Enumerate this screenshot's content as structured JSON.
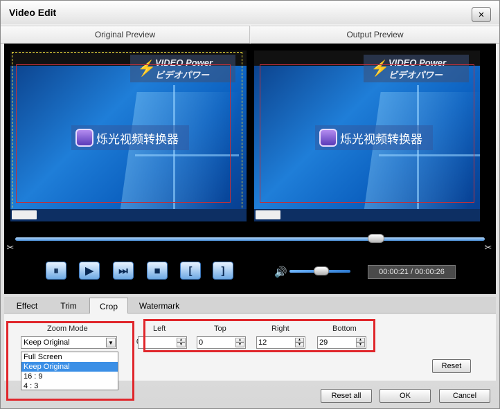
{
  "window": {
    "title": "Video Edit",
    "close_icon": "×"
  },
  "preview": {
    "original_label": "Original Preview",
    "output_label": "Output Preview"
  },
  "video": {
    "logo_line1": "VIDEO Power",
    "logo_line2": "ビデオパワー",
    "banner_text": "烁光视频转换器"
  },
  "controls": {
    "pause_icon": "⏸",
    "play_icon": "▶",
    "next_frame_icon": "⏭",
    "stop_icon": "■",
    "mark_in_icon": "[",
    "mark_out_icon": "]",
    "volume_icon": "🔊",
    "timecode": "00:00:21 / 00:00:26",
    "seek_position": 0.77,
    "volume_level": 0.45
  },
  "tabs": [
    {
      "label": "Effect"
    },
    {
      "label": "Trim"
    },
    {
      "label": "Crop"
    },
    {
      "label": "Watermark"
    }
  ],
  "crop": {
    "zoom_mode_label": "Zoom Mode",
    "zoom_mode_value": "Keep Original",
    "zoom_options": [
      "Full Screen",
      "Keep Original",
      "16 : 9",
      "4 : 3"
    ],
    "prefix_value": "0",
    "left_label": "Left",
    "top_label": "Top",
    "right_label": "Right",
    "bottom_label": "Bottom",
    "left_value": "",
    "top_value": "0",
    "right_value": "12",
    "bottom_value": "29",
    "reset_label": "Reset"
  },
  "footer": {
    "reset_all_label": "Reset all",
    "ok_label": "OK",
    "cancel_label": "Cancel"
  },
  "colors": {
    "highlight": "#e0262b",
    "accent": "#3b8fe6"
  }
}
